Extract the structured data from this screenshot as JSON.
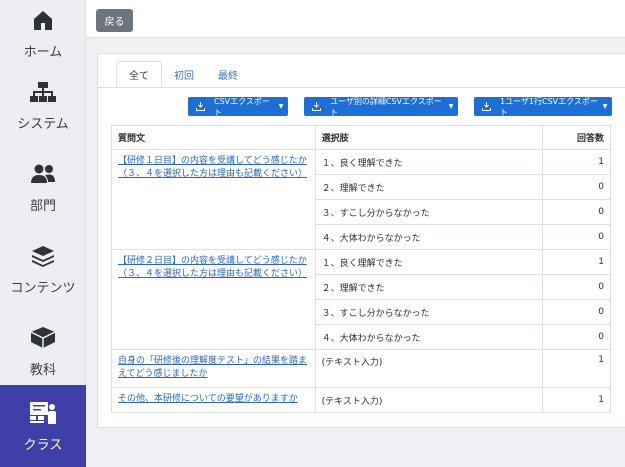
{
  "sidebar": {
    "items": [
      {
        "label": "ホーム",
        "icon": "home-icon"
      },
      {
        "label": "システム",
        "icon": "sitemap-icon"
      },
      {
        "label": "部門",
        "icon": "users-icon"
      },
      {
        "label": "コンテンツ",
        "icon": "layers-icon"
      },
      {
        "label": "教科",
        "icon": "book-icon"
      },
      {
        "label": "クラス",
        "icon": "classroom-icon"
      }
    ],
    "active_index": 5
  },
  "toolbar": {
    "back_label": "戻る"
  },
  "tabs": [
    {
      "label": "全て"
    },
    {
      "label": "初回"
    },
    {
      "label": "最終"
    }
  ],
  "export_buttons": [
    {
      "label": "CSVエクスポート"
    },
    {
      "label": "ユーザ別の詳細CSVエクスポート"
    },
    {
      "label": "1ユーザ1行CSVエクスポート"
    }
  ],
  "table": {
    "headers": [
      "質問文",
      "選択肢",
      "回答数"
    ],
    "questions": [
      {
        "text": "【研修１日目】の内容を受講してどう感じたか（３、４を選択した方は理由も記載ください）",
        "rows": [
          {
            "choice": "１、良く理解できた",
            "count": "1"
          },
          {
            "choice": "２、理解できた",
            "count": "0"
          },
          {
            "choice": "３、すこし分からなかった",
            "count": "0"
          },
          {
            "choice": "４、大体わからなかった",
            "count": "0"
          }
        ]
      },
      {
        "text": "【研修２日目】の内容を受講してどう感じたか（３、４を選択した方は理由も記載ください）",
        "rows": [
          {
            "choice": "１、良く理解できた",
            "count": "1"
          },
          {
            "choice": "２、理解できた",
            "count": "0"
          },
          {
            "choice": "３、すこし分からなかった",
            "count": "0"
          },
          {
            "choice": "４、大体わからなかった",
            "count": "0"
          }
        ]
      },
      {
        "text": "自身の「研修後の理解度テスト」の結果を踏まえてどう感じましたか",
        "rows": [
          {
            "choice": "(テキスト入力)",
            "count": "1"
          }
        ]
      },
      {
        "text": "その他、本研修についての要望がありますか",
        "rows": [
          {
            "choice": "(テキスト入力)",
            "count": "1"
          }
        ]
      }
    ]
  }
}
